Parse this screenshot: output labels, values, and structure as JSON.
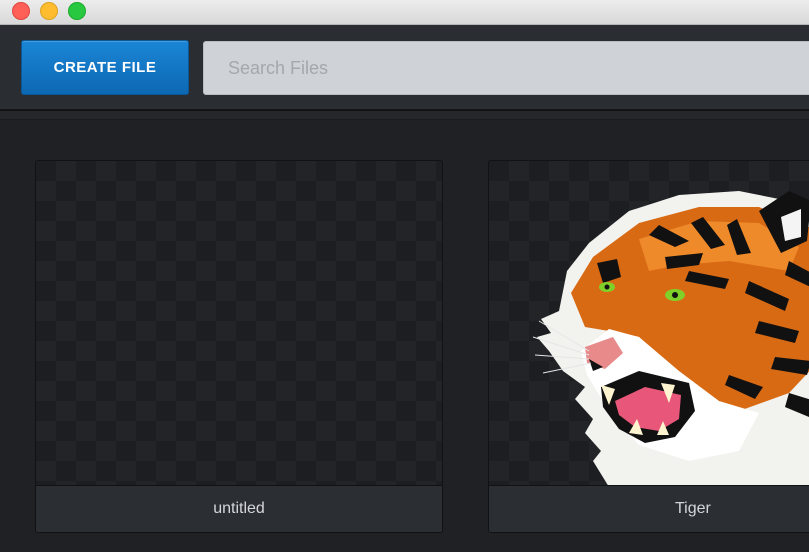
{
  "toolbar": {
    "create_label": "CREATE FILE",
    "search_placeholder": "Search Files",
    "search_value": ""
  },
  "files": [
    {
      "name": "untitled"
    },
    {
      "name": "Tiger"
    }
  ],
  "colors": {
    "accent": "#1a86d6",
    "background": "#1f2124",
    "toolbar": "#2a2d31"
  }
}
